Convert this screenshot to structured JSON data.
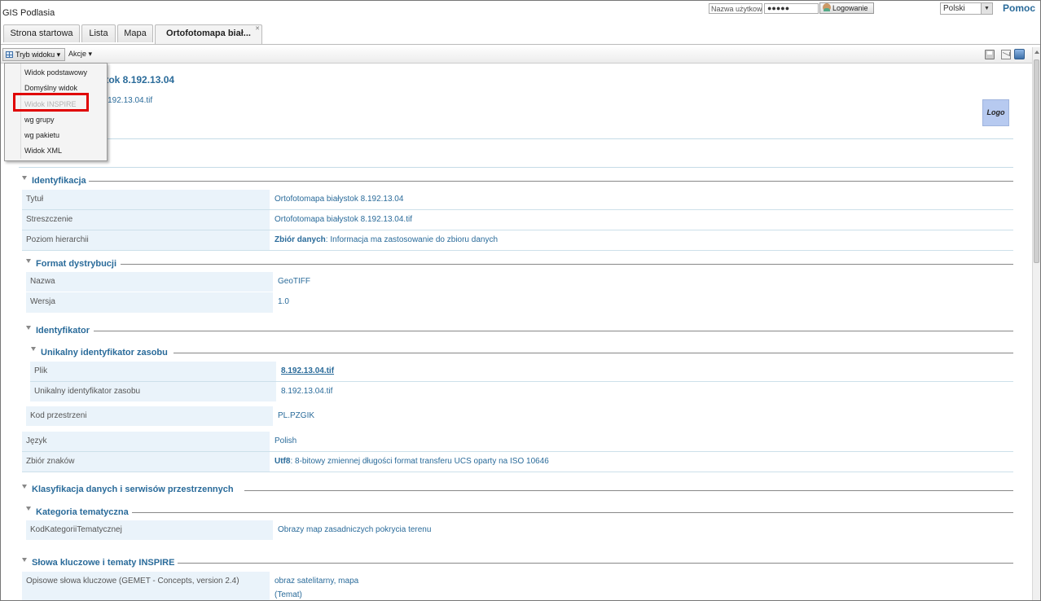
{
  "app": {
    "title": "GIS Podlasia"
  },
  "login": {
    "username_placeholder": "Nazwa użytkownika",
    "password_masked": "●●●●●",
    "login_label": "Logowanie",
    "language": "Polski",
    "help": "Pomoc"
  },
  "tabs": [
    {
      "label": "Strona startowa"
    },
    {
      "label": "Lista"
    },
    {
      "label": "Mapa"
    },
    {
      "label": "Ortofotomapa biał..."
    }
  ],
  "toolbar": {
    "view_mode": "Tryb widoku ▾",
    "actions": "Akcje ▾"
  },
  "menu": {
    "items": [
      {
        "label": "Widok podstawowy"
      },
      {
        "label": "Domyślny widok"
      },
      {
        "label": "Widok INSPIRE"
      },
      {
        "label": "wg grupy"
      },
      {
        "label": "wg pakietu"
      },
      {
        "label": "Widok XML"
      }
    ]
  },
  "doc": {
    "title_visible": "ystok 8.192.13.04",
    "subtitle_visible": "k 8.192.13.04.tif",
    "logo": "Logo"
  },
  "sections": {
    "identification": {
      "title": "Identyfikacja",
      "rows": [
        {
          "label": "Tytuł",
          "value": "Ortofotomapa białystok 8.192.13.04"
        },
        {
          "label": "Streszczenie",
          "value": "Ortofotomapa białystok 8.192.13.04.tif"
        },
        {
          "label": "Poziom hierarchii",
          "value_bold": "Zbiór danych",
          "value": ": Informacja ma zastosowanie do zbioru danych"
        }
      ]
    },
    "distribution_format": {
      "title": "Format dystrybucji",
      "rows": [
        {
          "label": "Nazwa",
          "value": "GeoTIFF"
        },
        {
          "label": "Wersja",
          "value": "1.0"
        }
      ]
    },
    "identifier": {
      "title": "Identyfikator",
      "unique": {
        "title": "Unikalny identyfikator zasobu",
        "rows": [
          {
            "label": "Plik",
            "value": "8.192.13.04.tif"
          },
          {
            "label": "Unikalny identyfikator zasobu",
            "value": "8.192.13.04.tif"
          }
        ]
      },
      "space_code": {
        "label": "Kod przestrzeni",
        "value": "PL.PZGIK"
      }
    },
    "misc": {
      "rows": [
        {
          "label": "Język",
          "value": "Polish"
        },
        {
          "label": "Zbiór znaków",
          "value_bold": "Utf8",
          "value": ": 8-bitowy zmiennej długości format transferu UCS oparty na ISO 10646"
        }
      ]
    },
    "classification": {
      "title": "Klasyfikacja danych i serwisów przestrzennych",
      "category": {
        "title": "Kategoria tematyczna",
        "rows": [
          {
            "label": "KodKategoriiTematycznej",
            "value": "Obrazy map zasadniczych pokrycia terenu"
          }
        ]
      }
    },
    "keywords": {
      "title": "Słowa kluczowe i tematy INSPIRE",
      "rows": [
        {
          "label": "Opisowe słowa kluczowe (GEMET - Concepts, version 2.4)",
          "value": "obraz satelitarny, mapa",
          "value2": "(Temat)"
        }
      ]
    }
  }
}
